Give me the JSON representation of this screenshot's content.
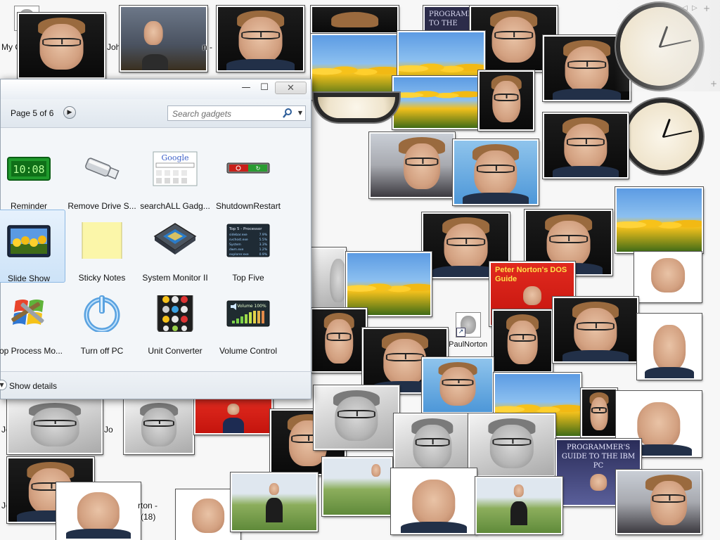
{
  "gallery": {
    "page_label": "Page 5 of 6",
    "search_placeholder": "Search gadgets",
    "show_details_label": "Show details",
    "gadgets": [
      {
        "label": "Reminder",
        "icon": "reminder-clock-icon"
      },
      {
        "label": "Remove Drive S...",
        "icon": "usb-drive-icon"
      },
      {
        "label": "searchALL Gadg...",
        "icon": "google-search-icon"
      },
      {
        "label": "ShutdownRestart",
        "icon": "shutdown-restart-icon"
      },
      {
        "label": "Slide Show",
        "icon": "slideshow-icon",
        "selected": true
      },
      {
        "label": "Sticky Notes",
        "icon": "sticky-note-icon"
      },
      {
        "label": "System Monitor II",
        "icon": "cpu-chip-icon"
      },
      {
        "label": "Top Five",
        "icon": "top-five-monitor-icon"
      },
      {
        "label": "Top Process Mo...",
        "icon": "windows-tools-icon"
      },
      {
        "label": "Turn off PC",
        "icon": "power-icon"
      },
      {
        "label": "Unit Converter",
        "icon": "unit-converter-icon"
      },
      {
        "label": "Volume Control",
        "icon": "volume-control-icon"
      }
    ],
    "reminder_display": "10:08",
    "google_logo_text": "Google",
    "top_five": {
      "title": "Top 5 - Processor",
      "rows": [
        [
          "sidebar.exe",
          "7.9%"
        ],
        [
          "svchost.exe",
          "5.5%"
        ],
        [
          "System",
          "3.3%"
        ],
        [
          "dwm.exe",
          "1.2%"
        ],
        [
          "explorer.exe",
          "0.9%"
        ]
      ]
    },
    "volume_label": "Volume 100%"
  },
  "desktop": {
    "labels": [
      "My C",
      "Joh",
      "n -",
      "Jo",
      "Jo",
      "Jo",
      "Jo",
      "J",
      "rton -",
      "(18)",
      "ePaulNorton"
    ],
    "books": {
      "programmers_guide_top": "PROGRAMM TO THE",
      "dos_guide": "Peter Norton's DOS Guide",
      "ibm_pc": "PROGRAMMER'S GUIDE TO THE IBM PC"
    }
  },
  "colors": {
    "window_bg": "#f3f6f9",
    "selection": "#cde3f8",
    "sticky_note": "#fbf6a9",
    "reminder_green": "#1f9a2c"
  }
}
